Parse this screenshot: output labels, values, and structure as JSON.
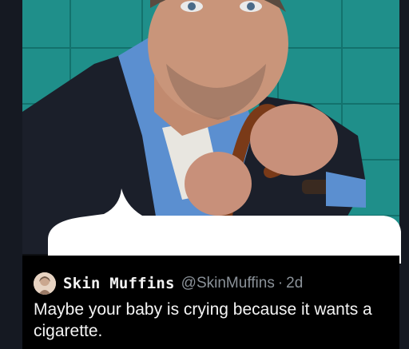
{
  "tweet": {
    "author_name": "Skin Muffins",
    "handle": "@SkinMuffins",
    "separator": "·",
    "age": "2d",
    "text": "Maybe your baby is crying because it wants a cigarette."
  },
  "image": {
    "icon": "meme-photo",
    "accent_colors": {
      "background": "#1f8f8a",
      "jacket": "#1b1f2a",
      "shirt": "#5b8fd0",
      "bubble": "#ffffff"
    }
  }
}
